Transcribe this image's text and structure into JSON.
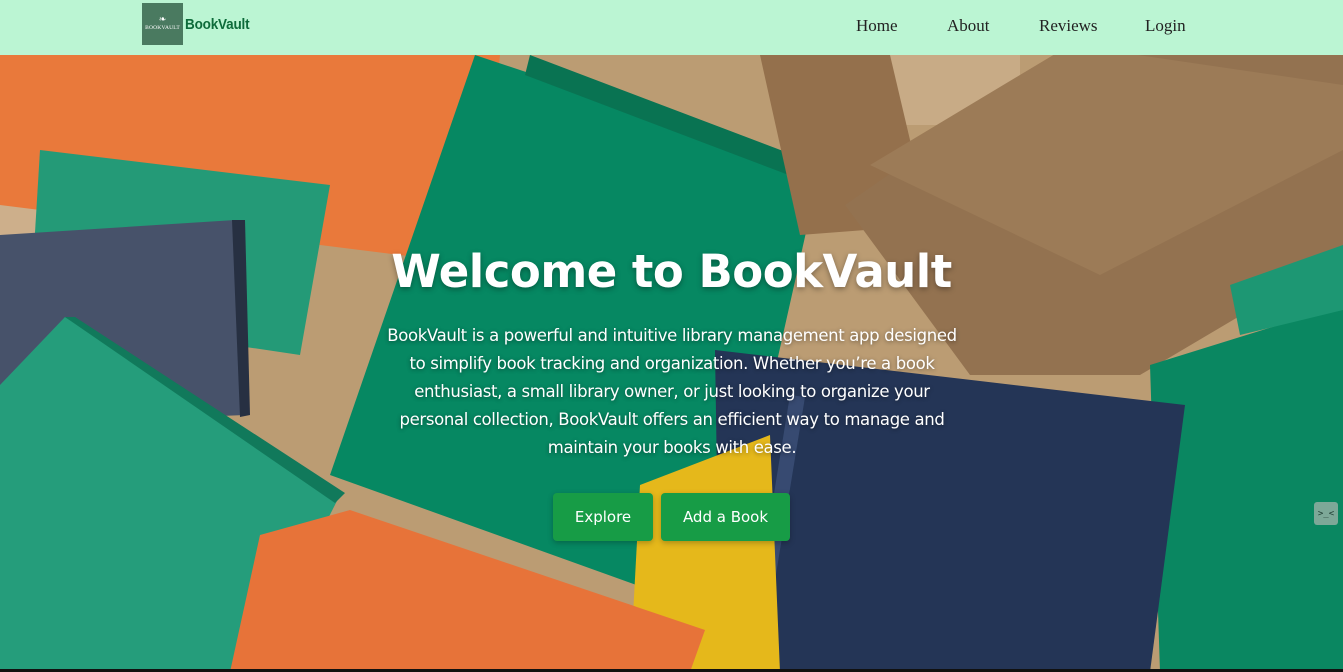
{
  "navbar": {
    "logo_text": "BOOKVAULT",
    "brand": "BookVault",
    "links": [
      "Home",
      "About",
      "Reviews",
      "Login"
    ]
  },
  "hero": {
    "title": "Welcome to BookVault",
    "description": "BookVault is a powerful and intuitive library management app designed to simplify book tracking and organization. Whether you’re a book enthusiast, a small library owner, or just looking to organize your personal collection, BookVault offers an efficient way to manage and maintain your books with ease.",
    "buttons": {
      "explore": "Explore",
      "add_book": "Add a Book"
    }
  },
  "side_widget": {
    "glyph": ">_<"
  },
  "colors": {
    "navbar_bg": "#bbf5d3",
    "brand_text": "#0d6b3a",
    "button_bg": "#179c46"
  }
}
